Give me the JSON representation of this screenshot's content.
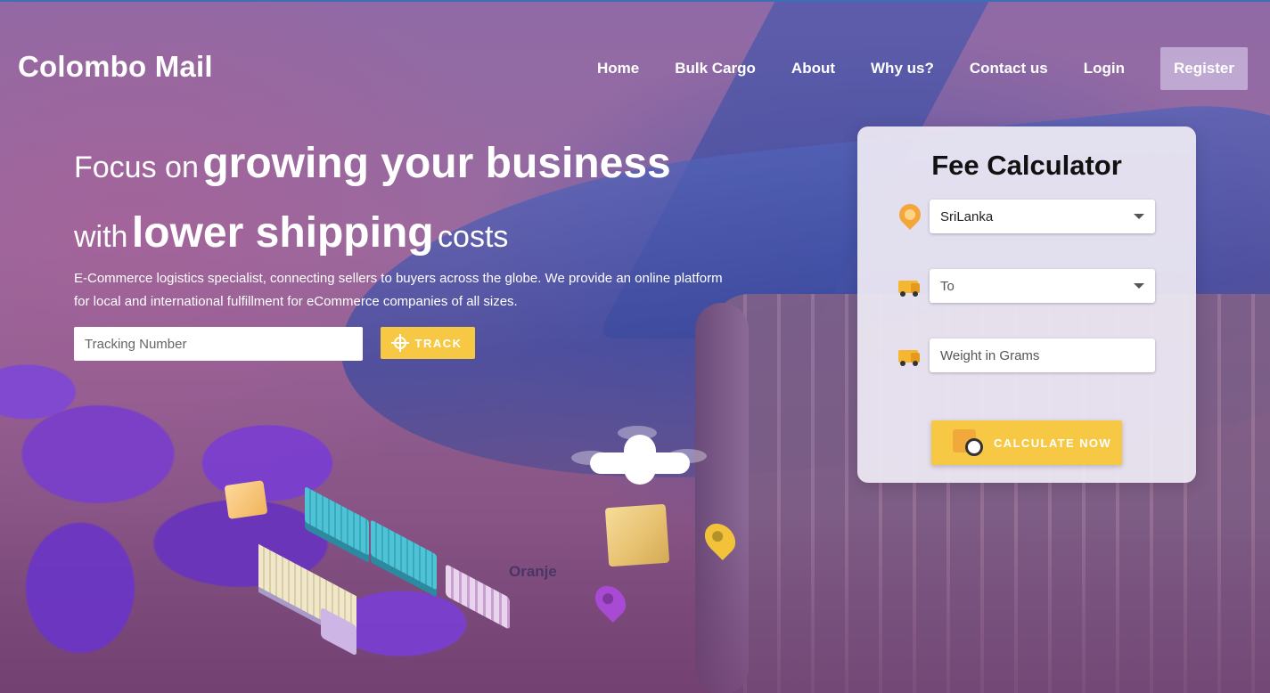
{
  "header": {
    "brand": "Colombo Mail",
    "nav": [
      {
        "label": "Home"
      },
      {
        "label": "Bulk Cargo"
      },
      {
        "label": "About"
      },
      {
        "label": "Why us?"
      },
      {
        "label": "Contact us"
      },
      {
        "label": "Login"
      },
      {
        "label": "Register"
      }
    ]
  },
  "hero": {
    "line1_light": "Focus on",
    "line1_bold": "growing your business",
    "line2_light_start": "with",
    "line2_bold": "lower shipping",
    "line2_light_end": "costs",
    "description": "E-Commerce logistics specialist, connecting sellers to buyers across the globe. We provide an online platform for local and international fulfillment for eCommerce companies of all sizes.",
    "tracking": {
      "placeholder": "Tracking Number",
      "button_label": "TRACK",
      "button_icon": "crosshair-icon"
    }
  },
  "scene": {
    "aircraft_text": "Oranje"
  },
  "calculator": {
    "title": "Fee Calculator",
    "from": {
      "value": "SriLanka",
      "icon": "location-pin-icon"
    },
    "to": {
      "placeholder": "To",
      "icon": "delivery-truck-icon"
    },
    "weight": {
      "placeholder": "Weight in Grams",
      "icon": "package-truck-icon"
    },
    "button_label": "CALCULATE NOW",
    "button_icon": "package-face-icon"
  },
  "colors": {
    "accent": "#f7c844",
    "panel": "#eeeaf4",
    "text_light": "#ffffff"
  }
}
